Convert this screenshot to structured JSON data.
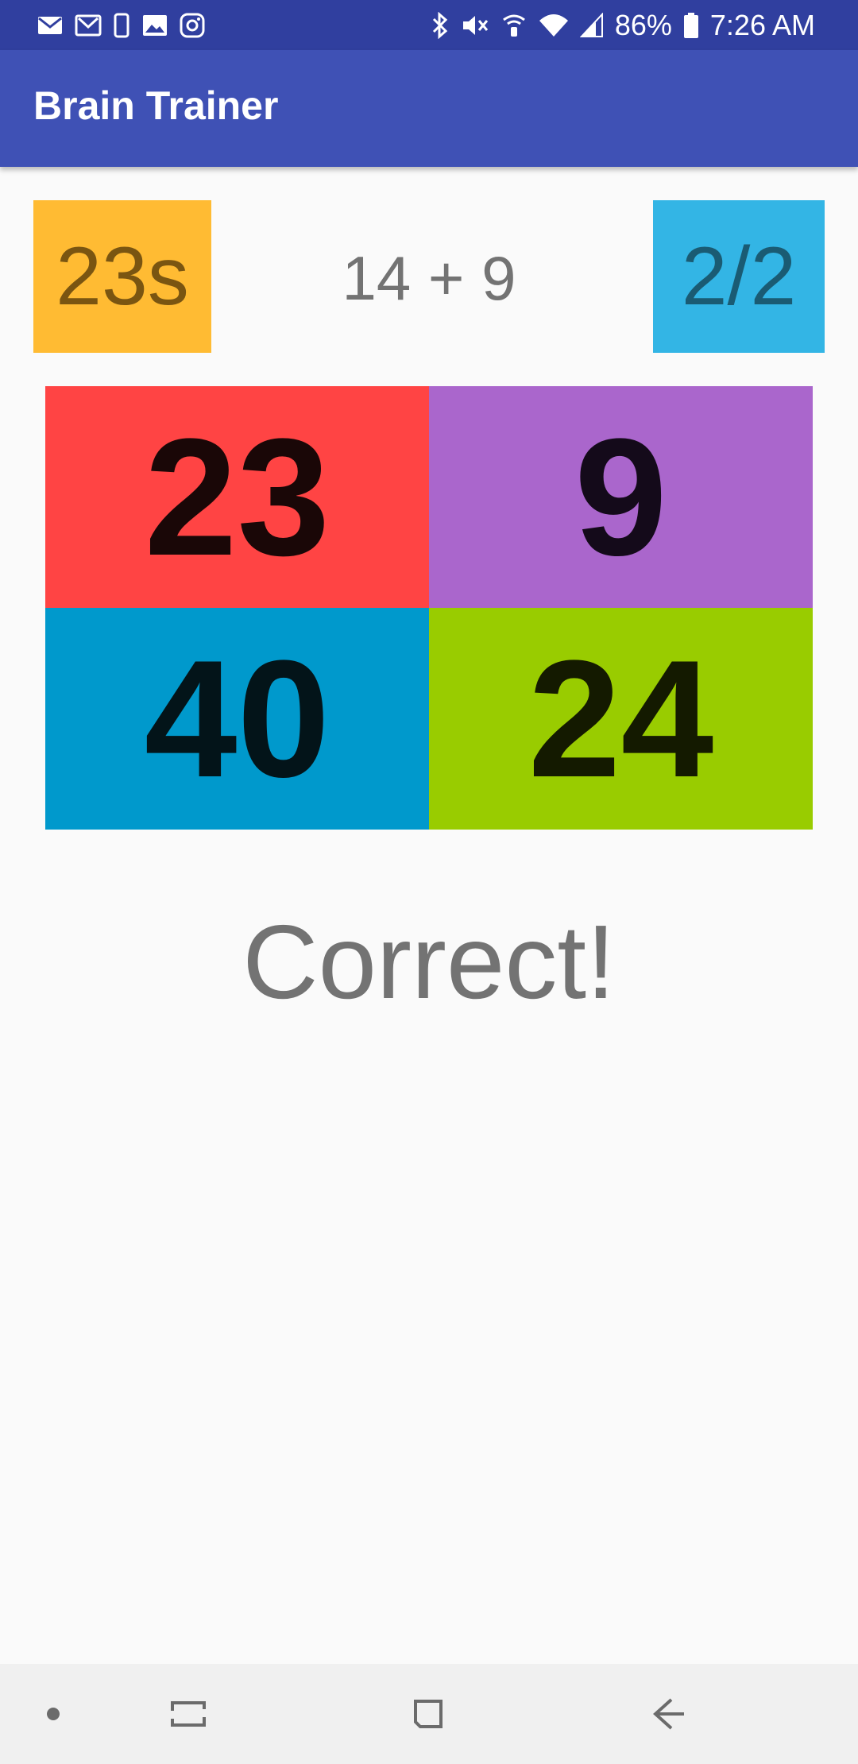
{
  "status_bar": {
    "battery_percent": "86%",
    "time": "7:26 AM",
    "left_icons": [
      "email-icon",
      "gmail-icon",
      "phone-outline-icon",
      "image-icon",
      "instagram-icon"
    ],
    "right_icons": [
      "bluetooth-icon",
      "mute-icon",
      "wifi-calling-icon",
      "wifi-icon",
      "signal-icon",
      "battery-icon"
    ]
  },
  "app_bar": {
    "title": "Brain Trainer"
  },
  "game": {
    "timer": "23s",
    "question": "14 + 9",
    "score": "2/2",
    "answers": [
      {
        "label": "23",
        "color": "#ff4444",
        "text_color": "#1a0707"
      },
      {
        "label": "9",
        "color": "#aa66cc",
        "text_color": "#140a1a"
      },
      {
        "label": "40",
        "color": "#0099cc",
        "text_color": "#031419"
      },
      {
        "label": "24",
        "color": "#99cc00",
        "text_color": "#141a00"
      }
    ],
    "result": "Correct!"
  },
  "colors": {
    "status_bar": "#303f9f",
    "app_bar": "#3f51b5",
    "timer_bg": "#ffbb33",
    "score_bg": "#33b5e5",
    "background": "#fafafa"
  },
  "nav_bar": {
    "buttons": [
      "dot-icon",
      "recent-apps-icon",
      "home-icon",
      "back-icon"
    ]
  }
}
